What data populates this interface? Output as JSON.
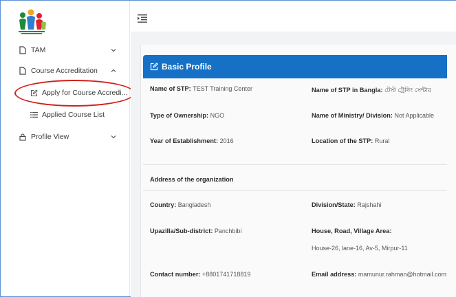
{
  "sidebar": {
    "items": [
      {
        "label": "TAM"
      },
      {
        "label": "Course Accreditation"
      },
      {
        "label": "Apply for Course Accredi..."
      },
      {
        "label": "Applied Course List"
      },
      {
        "label": "Profile View"
      }
    ]
  },
  "card": {
    "title": "Basic Profile"
  },
  "profile": {
    "name_stp_label": "Name of STP:",
    "name_stp_value": "TEST Training Center",
    "name_bangla_label": "Name of STP in Bangla:",
    "name_bangla_value": "টেস্ট ট্রেনিং সেন্টার",
    "ownership_label": "Type of Ownership:",
    "ownership_value": "NGO",
    "ministry_label": "Name of Ministry/ Division:",
    "ministry_value": "Not Applicable",
    "year_label": "Year of Establishment:",
    "year_value": "2016",
    "location_label": "Location of the STP:",
    "location_value": "Rural"
  },
  "address": {
    "section_title": "Address of the organization",
    "country_label": "Country:",
    "country_value": "Bangladesh",
    "division_label": "Division/State:",
    "division_value": "Rajshahi",
    "upazila_label": "Upazilla/Sub-district:",
    "upazila_value": "Panchbibi",
    "house_label": "House, Road, Village Area:",
    "house_value": "House-26, lane-16, Av-5, Mirpur-11",
    "contact_label": "Contact number:",
    "contact_value": "+8801741718819",
    "email_label": "Email address:",
    "email_value": "mamunur.rahman@hotmail.com"
  },
  "colors": {
    "accent": "#1670c6",
    "highlight": "#d0201c",
    "frame": "#5a8fd6"
  }
}
